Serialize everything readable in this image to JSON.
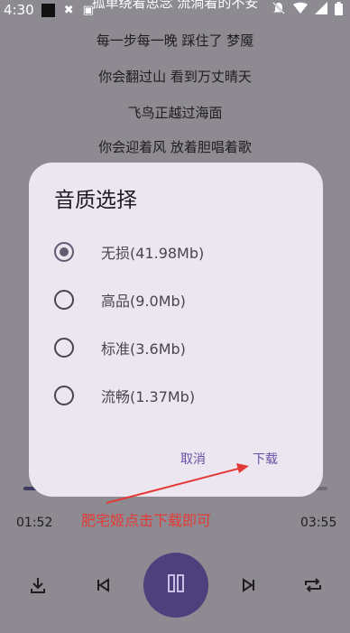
{
  "status_bar": {
    "time": "4:30"
  },
  "lyrics": {
    "partial_top": "孤单绕着思念 流淌着的不安",
    "lines": [
      "每一步每一晚 踩住了 梦魇",
      "你会翻过山 看到万丈晴天",
      "飞鸟正越过海面",
      "你会迎着风 放着胆唱着歌"
    ]
  },
  "player": {
    "elapsed": "01:52",
    "duration": "03:55",
    "progress_fraction": 0.476
  },
  "dialog": {
    "title": "音质选择",
    "options": [
      {
        "label": "无损(41.98Mb)",
        "selected": true
      },
      {
        "label": "高品(9.0Mb)",
        "selected": false
      },
      {
        "label": "标准(3.6Mb)",
        "selected": false
      },
      {
        "label": "流畅(1.37Mb)",
        "selected": false
      }
    ],
    "cancel_label": "取消",
    "confirm_label": "下载"
  },
  "annotation": {
    "text": "肥宅姬点击下载即可"
  },
  "colors": {
    "accent": "#6750a4",
    "play_button": "#4e3f7d",
    "annotation": "#e53935",
    "dialog_bg": "#ece6f0",
    "scrim": "#8d8a91"
  },
  "icons": {
    "download": "download-icon",
    "previous": "skip-previous-icon",
    "pause": "pause-icon",
    "next": "skip-next-icon",
    "repeat": "repeat-icon"
  }
}
